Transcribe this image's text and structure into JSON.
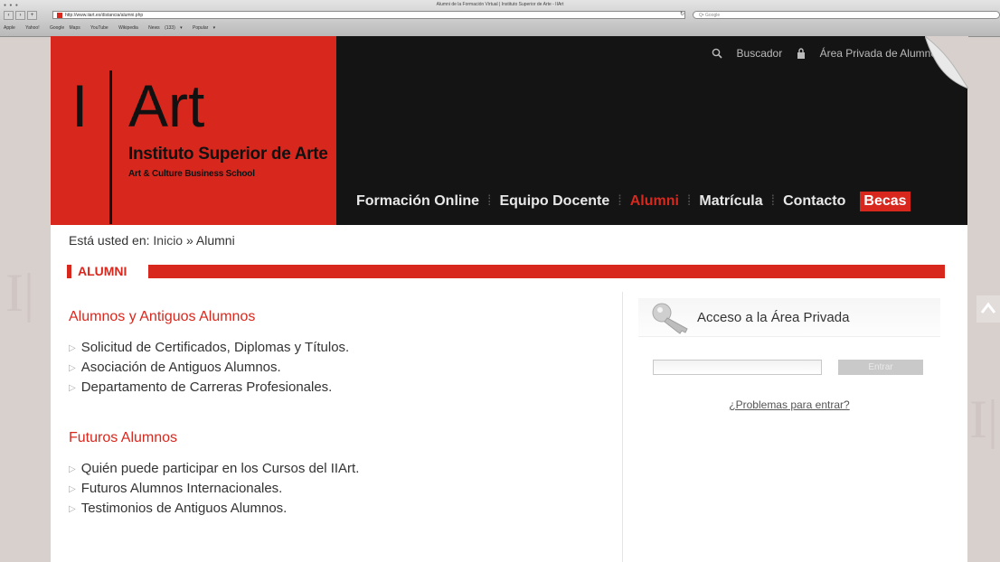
{
  "browser": {
    "window_title": "Alumni de la Formación Virtual | Instituto Superior de Arte - IIArt",
    "url": "http://www.iiart.es/distancia/alumni.php",
    "search_placeholder": "Q• Google",
    "bookmarks": [
      "Apple",
      "Yahoo!",
      "Google Maps",
      "YouTube",
      "Wikipedia",
      "News (133) ▾",
      "Popular ▾"
    ]
  },
  "logo": {
    "letter": "I",
    "word": "Art",
    "subtitle": "Instituto Superior de Arte",
    "tagline": "Art & Culture Business School"
  },
  "toplinks": {
    "search": "Buscador",
    "private": "Área Privada de Alumnos"
  },
  "nav": {
    "items": [
      "Formación Online",
      "Equipo Docente",
      "Alumni",
      "Matrícula",
      "Contacto"
    ],
    "becas": "Becas"
  },
  "breadcrumb": {
    "prefix": "Está usted en:",
    "home": "Inicio",
    "sep": "»",
    "current": "Alumni"
  },
  "section": {
    "title": "ALUMNI"
  },
  "content": {
    "group1": {
      "title": "Alumnos y Antiguos Alumnos",
      "items": [
        "Solicitud de Certificados, Diplomas y Títulos.",
        "Asociación de Antiguos Alumnos.",
        "Departamento de Carreras Profesionales."
      ]
    },
    "group2": {
      "title": "Futuros Alumnos",
      "items": [
        "Quién puede participar en los Cursos del IIArt.",
        "Futuros Alumnos Internacionales.",
        "Testimonios de Antiguos Alumnos."
      ]
    }
  },
  "private_access": {
    "title": "Acceso a la Área Privada",
    "button": "Entrar",
    "help_link": "¿Problemas para entrar?"
  },
  "colors": {
    "brand_red": "#d8281e",
    "header_black": "#141414"
  }
}
